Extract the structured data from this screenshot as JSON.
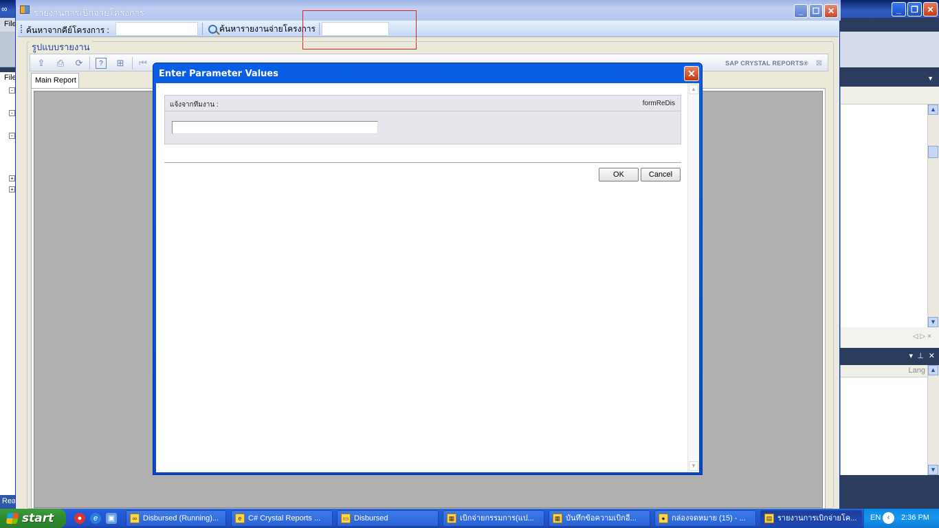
{
  "vs": {
    "menu_file": "File",
    "left_label": "File",
    "status_label": "Rea",
    "right_col_header": "Lang",
    "ctrl_minimize": "_",
    "ctrl_restore": "❐",
    "ctrl_close": "✕"
  },
  "app": {
    "title": "รายงานการเบิกจ่ายโครงการ",
    "toolbar": {
      "search_key_label": "ค้นหาจากคีย์โครงการ :",
      "search_key_value": "",
      "search_report_button": "ค้นหารายงานจ่ายโครงการ",
      "search_report_value": ""
    },
    "group_title": "รูปแบบรายงาน",
    "crystal": {
      "brand": "SAP CRYSTAL REPORTS®",
      "tab_main": "Main Report"
    }
  },
  "dialog": {
    "title": "Enter Parameter Values",
    "param_label": "แจ้งจากทีมงาน :",
    "param_name": "formReDis",
    "param_value": "",
    "ok_label": "OK",
    "cancel_label": "Cancel"
  },
  "taskbar": {
    "start_label": "start",
    "tasks": [
      {
        "label": "Disbursed (Running)...",
        "icon": "vs-icon"
      },
      {
        "label": "C# Crystal Reports ...",
        "icon": "ie-icon"
      },
      {
        "label": "Disbursed",
        "icon": "folder-icon"
      },
      {
        "label": "เบิกจ่ายกรรมการ(แป...",
        "icon": "window-icon"
      },
      {
        "label": "บันทึกข้อความเบิกอี...",
        "icon": "window-icon"
      },
      {
        "label": "กล่องจดหมาย (15) - ...",
        "icon": "chrome-icon"
      },
      {
        "label": "รายงานการเบิกจ่ายโค...",
        "icon": "app-icon"
      }
    ],
    "tray_lang": "EN",
    "clock": "2:36 PM"
  }
}
